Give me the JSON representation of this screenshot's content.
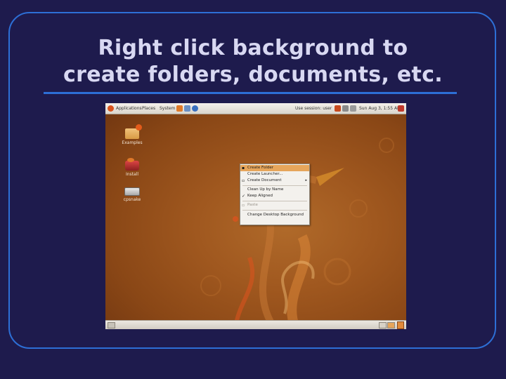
{
  "slide": {
    "title_line1": "Right click background to",
    "title_line2": "create folders, documents, etc."
  },
  "top_panel": {
    "menus": [
      "Applications",
      "Places",
      "System"
    ],
    "user_label": "Use session: user",
    "clock": "Sun Aug 3, 1:55 AM"
  },
  "desktop_icons": [
    {
      "label": "Examples",
      "icon": "folder-icon"
    },
    {
      "label": "Install",
      "icon": "installer-icon"
    },
    {
      "label": "cpsnake",
      "icon": "drive-icon"
    }
  ],
  "context_menu": {
    "items": [
      {
        "label": "Create Folder",
        "highlighted": true
      },
      {
        "label": "Create Launcher..."
      },
      {
        "label": "Create Document",
        "submenu": true
      },
      {
        "label": "Clean Up by Name"
      },
      {
        "label": "Keep Aligned",
        "checked": true
      },
      {
        "label": "Paste",
        "disabled": true
      },
      {
        "label": "Change Desktop Background"
      }
    ]
  },
  "colors": {
    "slide_background": "#1e1b4d",
    "accent_blue": "#2d6fd6",
    "title_text": "#d8d8f2",
    "desktop_orange": "#a0581f",
    "menu_highlight": "#e6a55b"
  }
}
